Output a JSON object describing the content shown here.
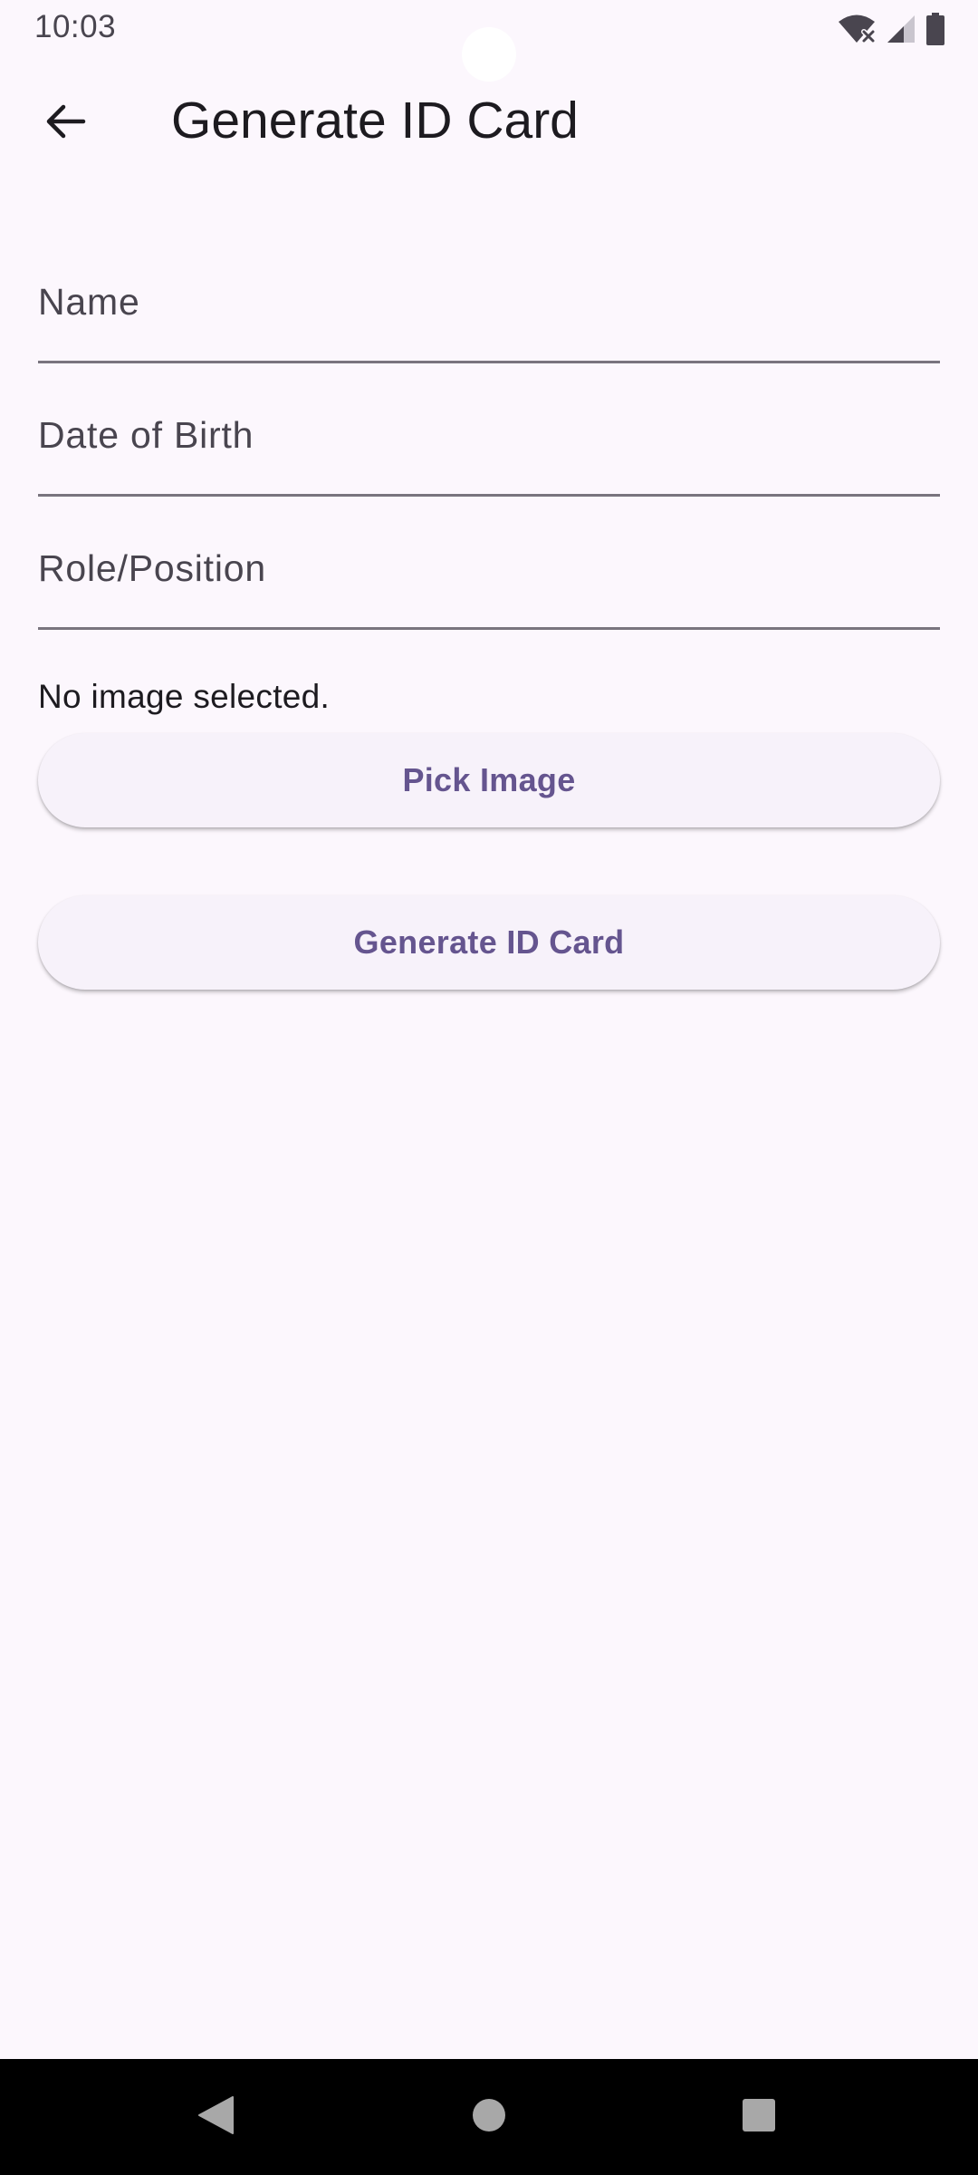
{
  "status_bar": {
    "time": "10:03",
    "icons": [
      "wifi-off-icon",
      "cellular-signal-icon",
      "battery-icon"
    ]
  },
  "app_bar": {
    "back_icon": "arrow-back-icon",
    "title": "Generate ID Card"
  },
  "form": {
    "fields": [
      {
        "label": "Name",
        "value": ""
      },
      {
        "label": "Date of Birth",
        "value": ""
      },
      {
        "label": "Role/Position",
        "value": ""
      }
    ],
    "image_status": "No image selected.",
    "pick_image_label": "Pick Image",
    "generate_label": "Generate ID Card"
  },
  "nav_bar": {
    "icons": [
      "back-triangle-icon",
      "home-circle-icon",
      "recents-square-icon"
    ]
  },
  "colors": {
    "background": "#FCF7FD",
    "button_text": "#65558F",
    "button_background": "#F7F2FA",
    "underline": "#79747E",
    "title_text": "#1D1B20"
  }
}
